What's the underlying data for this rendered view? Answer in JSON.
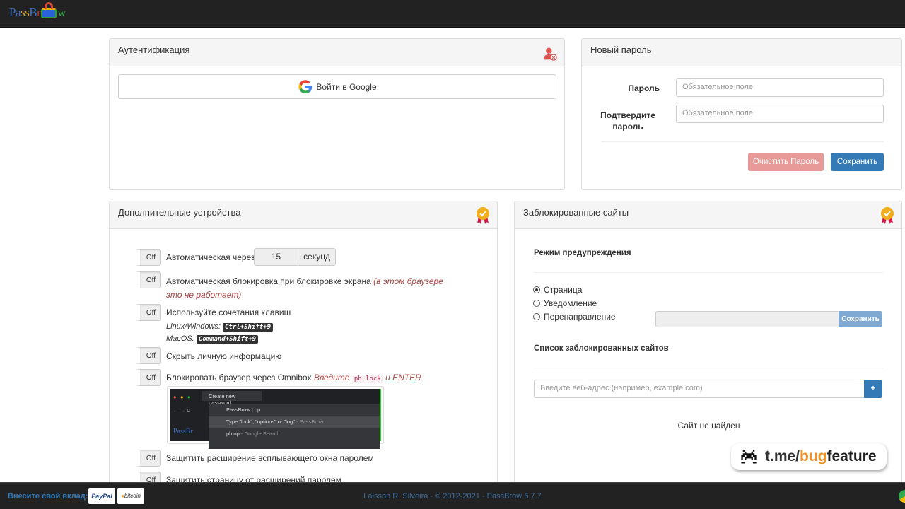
{
  "logo": {
    "text_pass": "PassBr",
    "text_w": "w"
  },
  "auth": {
    "title": "Аутентификация",
    "google_button": "Войти в Google"
  },
  "new_password": {
    "title": "Новый пароль",
    "password_label": "Пароль",
    "password_placeholder": "Обязательное поле",
    "confirm_label_1": "Подтвердите",
    "confirm_label_2": "пароль",
    "confirm_placeholder": "Обязательное поле",
    "clear_button": "Очистить Пароль",
    "save_button": "Сохранить"
  },
  "devices": {
    "title": "Дополнительные устройства",
    "toggle_off": "Off",
    "auto_lock": "Автоматическая через",
    "auto_lock_value": "15",
    "auto_lock_unit": "секунд",
    "screen_lock": "Автоматическая блокировка при блокировке экрана",
    "screen_lock_note": "(в этом браузере это не работает)",
    "shortcuts": "Используйте сочетания клавиш",
    "linux_label": "Linux/Windows:",
    "linux_keys": "Ctrl+Shift+9",
    "mac_label": "MacOS:",
    "mac_keys": "Command+Shift+9",
    "hide_info": "Скрыть личную информацию",
    "omnibox": "Блокировать браузер через Omnibox",
    "omnibox_note_1": "Введите",
    "omnibox_code": "pb lock",
    "omnibox_note_2": "и ENTER",
    "screenshot": {
      "tab": "Create new password",
      "address": "PassBrow",
      "typed": "op",
      "suggestion": "Type \"lock\", \"options\" or \"log\"",
      "suggestion_source": "- PassBrow",
      "search": "pb op",
      "search_source": "- Google Search"
    },
    "protect_popup": "Защитить расширение всплывающего окна паролем",
    "protect_page": "Защитить страницу от расширений паролем"
  },
  "blocked": {
    "title": "Заблокированные сайты",
    "mode_title": "Режим предупреждения",
    "modes": [
      "Страница",
      "Уведомление",
      "Перенаправление"
    ],
    "selected_mode": 0,
    "redirect_save": "Сохранить",
    "list_title": "Список заблокированных сайтов",
    "url_placeholder": "Введите веб-адрес (например, example.com)",
    "add_button": "+",
    "empty": "Сайт не найден"
  },
  "watermark": {
    "prefix": "t.me/",
    "mid": "bug",
    "suffix": "feature"
  },
  "footer": {
    "donate": "Внесите свой вклад:",
    "paypal": "PayPal",
    "bitcoin": "bitcoin",
    "copyright": "Laisson R. Silveira - © 2012-2021 - PassBrow 6.7.7"
  }
}
